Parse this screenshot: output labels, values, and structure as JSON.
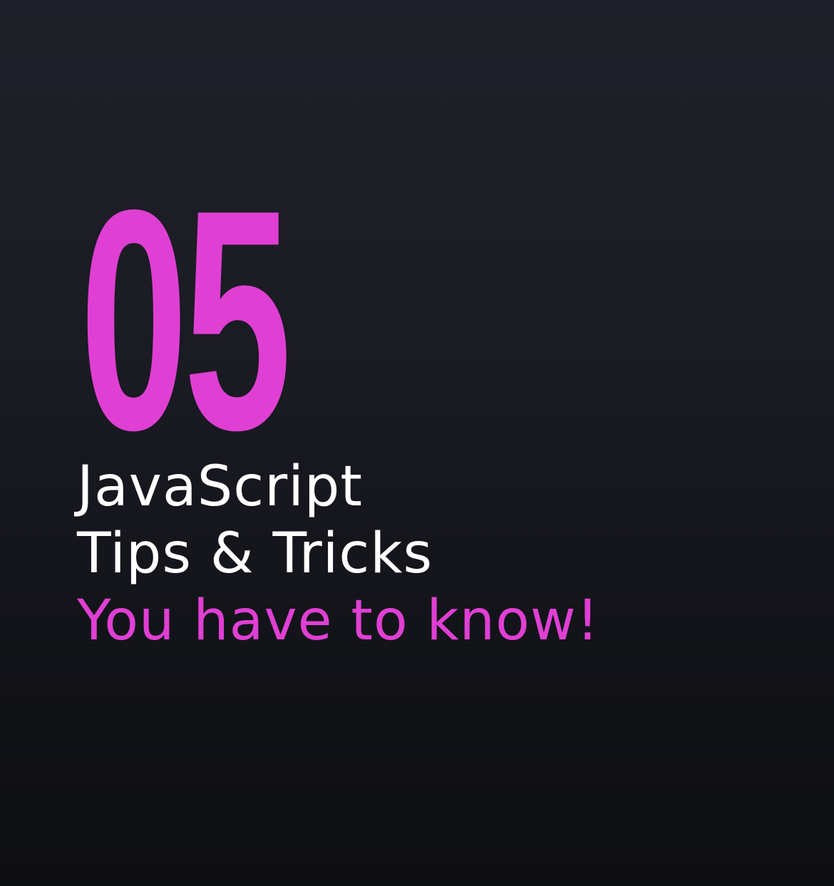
{
  "colors": {
    "accent": "#e03fd4",
    "text": "#ffffff",
    "background_top": "#1f2029",
    "background_bottom": "#0d0e12"
  },
  "card": {
    "number": "05",
    "title_line_1": "JavaScript",
    "title_line_2": "Tips & Tricks",
    "tagline": "You have to know!"
  }
}
